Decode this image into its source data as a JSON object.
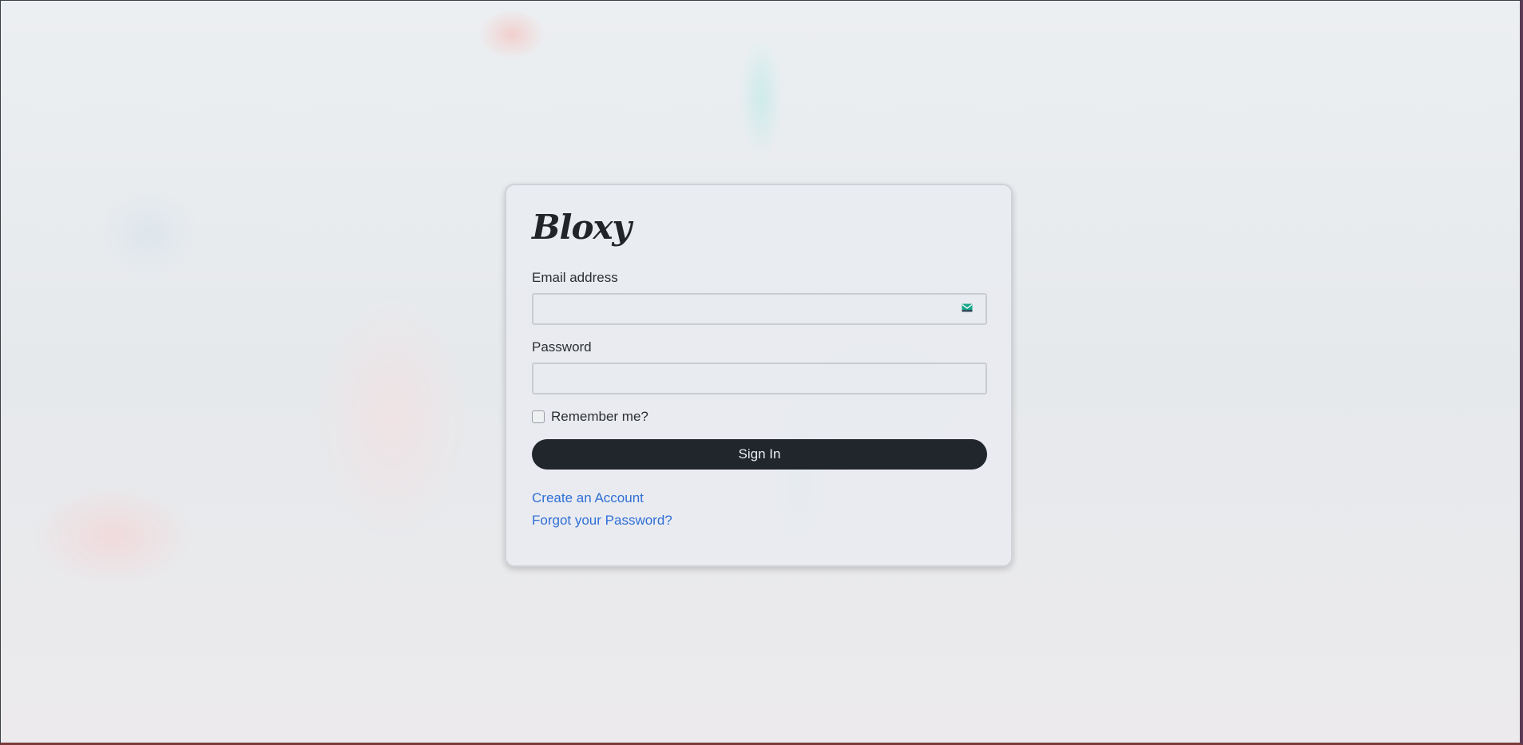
{
  "app": {
    "logo_text": "Bloxy"
  },
  "form": {
    "email_label": "Email address",
    "email_value": "",
    "email_placeholder": "",
    "email_icon": "envelope-icon",
    "password_label": "Password",
    "password_value": "",
    "password_placeholder": "",
    "remember_label": "Remember me?",
    "remember_checked": false,
    "signin_label": "Sign In"
  },
  "links": {
    "create_account": "Create an Account",
    "forgot_password": "Forgot your Password?"
  },
  "colors": {
    "button_bg": "#21252c",
    "link": "#2f6fd6",
    "icon_accent": "#17a589"
  }
}
